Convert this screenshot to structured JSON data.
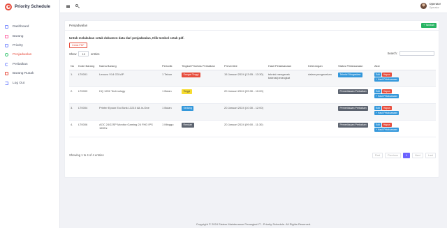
{
  "app": {
    "title": "Priority Schedule"
  },
  "sidebar": {
    "items": [
      {
        "label": "Dashboard",
        "icon": "dashboard-icon"
      },
      {
        "label": "Barang",
        "icon": "box-icon"
      },
      {
        "label": "Priority",
        "icon": "priority-icon"
      },
      {
        "label": "Penjadwalan",
        "icon": "calendar-icon",
        "active": true
      },
      {
        "label": "Perbaikan",
        "icon": "repair-icon"
      },
      {
        "label": "Barang Rusak",
        "icon": "broken-item-icon"
      },
      {
        "label": "Log Out",
        "icon": "logout-icon"
      }
    ]
  },
  "header": {
    "user_name": "Operator",
    "user_role": "Operator"
  },
  "card": {
    "title": "Penjadwalan",
    "add_label": "+ Tambah",
    "note": "Untuk melakukan cetak dokumen data dari penjadwalan, Klik tombol cetak pdf.",
    "pdf_label": "Cetak PDF"
  },
  "controls": {
    "show_label": "Show",
    "entries_value": "10",
    "entries_label": "entries",
    "search_label": "Search:"
  },
  "table": {
    "headers": [
      "No",
      "Kode Barang",
      "Nama Barang",
      "Periodik",
      "Tingkat Prioritas Perbaikan",
      "Preventive",
      "Hasil Pelaksanaan",
      "Keterangan",
      "Status Pelaksanaan",
      "Aksi"
    ],
    "rows": [
      {
        "no": "1.",
        "kode": "LT0001",
        "nama": "Lenovo V14 G3 IAP",
        "periodik": "1 Tahun",
        "prioritas": "Sangat Tinggi",
        "prioritas_color": "#e74c3c",
        "preventive": "15 Januari 2024 (13:05 - 13:30)",
        "hasil": "teknisi mengecek baterai/perangkat",
        "keterangan": "dalam pengecekan",
        "status": "Teknisi Ditugaskan",
        "status_color": "#3498db"
      },
      {
        "no": "2.",
        "kode": "LT0003",
        "nama": "HQ 1202 Technology",
        "periodik": "1 Bulan",
        "prioritas": "Tinggi",
        "prioritas_color": "#f7dc2f",
        "preventive": "20 Januari 2024 (09:30 - 10:00)",
        "hasil": "",
        "keterangan": "",
        "status": "Pemeriksaan Perbaikan",
        "status_color": "#5d6470"
      },
      {
        "no": "3.",
        "kode": "LT0004",
        "nama": "Printer Epson EcoTank L3210 All-In-One",
        "periodik": "1 Bulan",
        "prioritas": "Sedang",
        "prioritas_color": "#3498db",
        "preventive": "20 Januari 2024 (10:30 - 12:00)",
        "hasil": "",
        "keterangan": "",
        "status": "Pemeriksaan Perbaikan",
        "status_color": "#5d6470"
      },
      {
        "no": "4.",
        "kode": "LT0006",
        "nama": "AOC 24G2SP Monitor Gaming 24 FHD IPS 165Hz",
        "periodik": "1 Minggu",
        "prioritas": "Rendah",
        "prioritas_color": "#5d6470",
        "preventive": "20 Januari 2024 (09:00 - 11:30)",
        "hasil": "",
        "keterangan": "",
        "status": "Pemeriksaan Perbaikan",
        "status_color": "#5d6470"
      }
    ],
    "actions": {
      "edit": "Edit",
      "hapus": "Hapus",
      "hasil": "+ Hasil Pelaksanaan"
    }
  },
  "footer_info": "Showing 1 to 4 of 4 entries",
  "pagination": {
    "first": "First",
    "previous": "Previous",
    "current": "1",
    "next": "Next",
    "last": "Last"
  },
  "copyright": "Copyright © 2024 Sistem Maintenance Perangkat IT - Priority Schedule. All Rights Reserved."
}
